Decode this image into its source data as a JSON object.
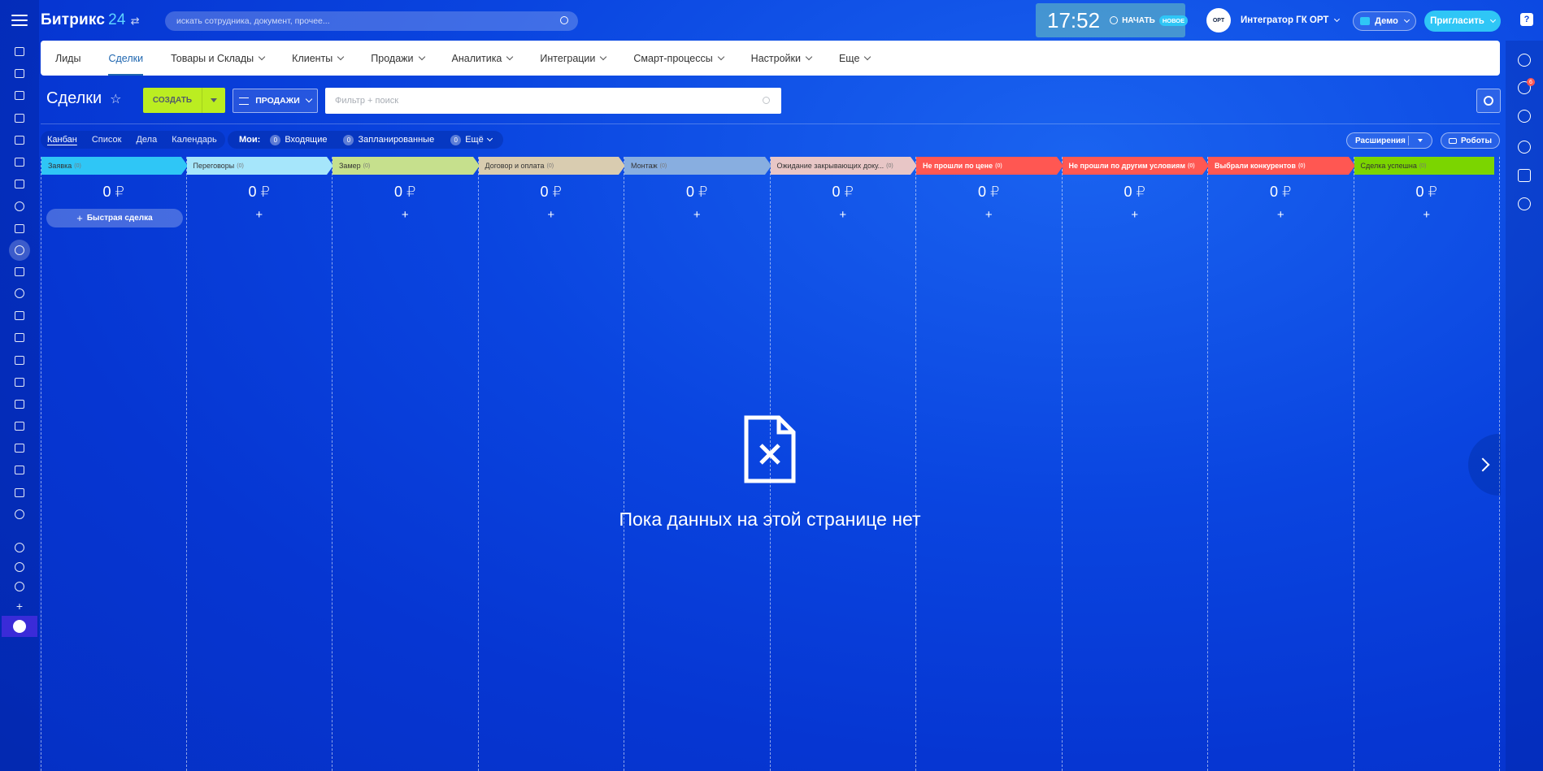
{
  "header": {
    "logo_text": "Битрикс",
    "logo_num": "24",
    "search_placeholder": "искать сотрудника, документ, прочее...",
    "time": "17:52",
    "start_label": "НАЧАТЬ",
    "new_badge": "НОВОЕ",
    "user_name": "Интегратор ГК ОРТ",
    "avatar_text": "ОРТ",
    "demo_label": "Демо",
    "invite_label": "Пригласить",
    "help_label": "?"
  },
  "nav": {
    "items": [
      {
        "label": "Лиды"
      },
      {
        "label": "Сделки"
      },
      {
        "label": "Товары и Склады"
      },
      {
        "label": "Клиенты"
      },
      {
        "label": "Продажи"
      },
      {
        "label": "Аналитика"
      },
      {
        "label": "Интеграции"
      },
      {
        "label": "Смарт-процессы"
      },
      {
        "label": "Настройки"
      },
      {
        "label": "Еще"
      }
    ]
  },
  "toolbar": {
    "page_title": "Сделки",
    "create_label": "СОЗДАТЬ",
    "sales_label": "ПРОДАЖИ",
    "filter_placeholder": "Фильтр + поиск"
  },
  "views": {
    "items": [
      "Канбан",
      "Список",
      "Дела",
      "Календарь"
    ],
    "mine_label": "Мои:",
    "incoming_count": "0",
    "incoming_label": "Входящие",
    "planned_count": "0",
    "planned_label": "Запланированные",
    "more_count": "0",
    "more_label": "Ещё",
    "extensions_label": "Расширения",
    "robots_label": "Роботы"
  },
  "kanban": {
    "quick_deal_label": "Быстрая сделка",
    "plus": "+",
    "columns": [
      {
        "title": "Заявка",
        "count": "(0)",
        "sum": "0 ₽",
        "color": "#2fc6f6"
      },
      {
        "title": "Переговоры",
        "count": "(0)",
        "sum": "0 ₽",
        "color": "#a6e6fb"
      },
      {
        "title": "Замер",
        "count": "(0)",
        "sum": "0 ₽",
        "color": "#c6e08d"
      },
      {
        "title": "Договор и оплата",
        "count": "(0)",
        "sum": "0 ₽",
        "color": "#d9ccb0"
      },
      {
        "title": "Монтаж",
        "count": "(0)",
        "sum": "0 ₽",
        "color": "#88aee0"
      },
      {
        "title": "Ожидание закрывающих доку...",
        "count": "(0)",
        "sum": "0 ₽",
        "color": "#e8c6c6"
      },
      {
        "title": "Не прошли по цене",
        "count": "(0)",
        "sum": "0 ₽",
        "color": "#ff5752"
      },
      {
        "title": "Не прошли по другим условиям",
        "count": "(0)",
        "sum": "0 ₽",
        "color": "#ff5752"
      },
      {
        "title": "Выбрали конкурентов",
        "count": "(0)",
        "sum": "0 ₽",
        "color": "#ff5752"
      },
      {
        "title": "Сделка успешна",
        "count": "(0)",
        "sum": "0 ₽",
        "color": "#7bd500"
      }
    ]
  },
  "empty_state": {
    "text": "Пока данных на этой странице нет"
  },
  "right_bar": {
    "notification_count": "6"
  }
}
